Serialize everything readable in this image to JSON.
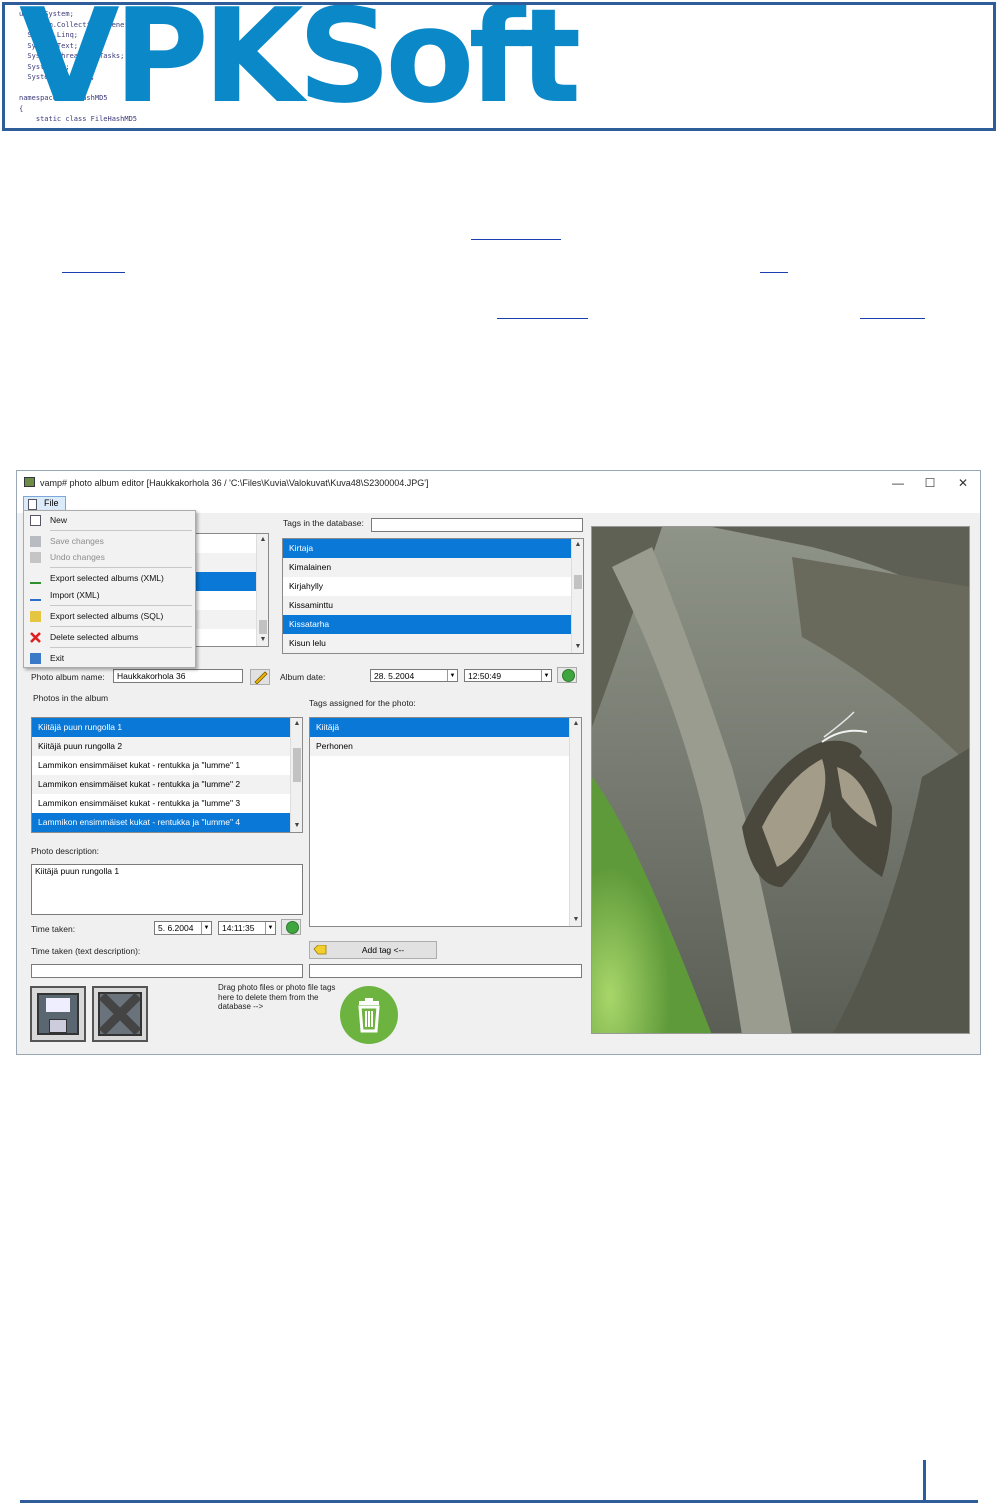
{
  "logo": {
    "text": "VPKSoft",
    "code_lines": [
      "using System;",
      "  System.Collections.Generic;",
      "  System.Linq;",
      "  System.Text;",
      "  System.Threading.Tasks;",
      "  System.IO;",
      "  System.Security;",
      "",
      "namespace FileHashMD5",
      "{",
      "    static class FileHashMD5"
    ]
  },
  "window": {
    "title": "vamp# photo album editor [Haukkakorhola 36 / 'C:\\Files\\Kuvia\\Valokuvat\\Kuva48\\S2300004.JPG']",
    "controls": {
      "minimize": "—",
      "maximize": "☐",
      "close": "✕"
    }
  },
  "menu": {
    "file_label": "File",
    "items": [
      {
        "label": "New",
        "icon": "new-document-icon",
        "enabled": true
      },
      {
        "label": "Save changes",
        "icon": "save-icon",
        "enabled": false
      },
      {
        "label": "Undo changes",
        "icon": "undo-icon",
        "enabled": false
      },
      {
        "label": "Export selected albums (XML)",
        "icon": "export-icon",
        "enabled": true
      },
      {
        "label": "Import (XML)",
        "icon": "import-icon",
        "enabled": true
      },
      {
        "label": "Export selected albums (SQL)",
        "icon": "export-sql-icon",
        "enabled": true
      },
      {
        "label": "Delete selected albums",
        "icon": "delete-icon",
        "enabled": true
      },
      {
        "label": "Exit",
        "icon": "exit-icon",
        "enabled": true
      }
    ]
  },
  "tags_db": {
    "label": "Tags in the database:",
    "filter_value": "",
    "items": [
      {
        "label": "Kirtaja",
        "selected": true
      },
      {
        "label": "Kimalainen",
        "selected": false
      },
      {
        "label": "Kirjahylly",
        "selected": false
      },
      {
        "label": "Kissaminttu",
        "selected": false
      },
      {
        "label": "Kissatarha",
        "selected": true
      },
      {
        "label": "Kisun lelu",
        "selected": false
      }
    ]
  },
  "album": {
    "name_label": "Photo album name:",
    "name_value": "Haukkakorhola 36",
    "date_label": "Album date:",
    "date_value": "28. 5.2004",
    "time_value": "12:50:49"
  },
  "photos": {
    "label": "Photos in the album",
    "items": [
      {
        "label": "Kiitäjä puun rungolla 1",
        "selected": true
      },
      {
        "label": "Kiitäjä puun rungolla 2",
        "selected": false
      },
      {
        "label": "Lammikon ensimmäiset kukat - rentukka ja \"lumme\" 1",
        "selected": false
      },
      {
        "label": "Lammikon ensimmäiset kukat - rentukka ja \"lumme\" 2",
        "selected": false
      },
      {
        "label": "Lammikon ensimmäiset kukat - rentukka ja \"lumme\" 3",
        "selected": false
      },
      {
        "label": "Lammikon ensimmäiset kukat - rentukka ja \"lumme\" 4",
        "selected": true
      }
    ]
  },
  "photo_tags": {
    "label": "Tags assigned for the photo:",
    "items": [
      {
        "label": "Kiitäjä",
        "selected": true
      },
      {
        "label": "Perhonen",
        "selected": false
      }
    ]
  },
  "description": {
    "label": "Photo description:",
    "value": "Kiitäjä puun rungolla 1"
  },
  "time_taken": {
    "label": "Time taken:",
    "date_value": "5. 6.2004",
    "time_value": "14:11:35",
    "text_label": "Time taken (text description):",
    "text_value": ""
  },
  "add_tag": {
    "label": "Add tag <--",
    "input_value": ""
  },
  "drag_hint": "Drag photo files or photo file tags here to delete them from the database -->",
  "colors": {
    "selection": "#0a78d7",
    "logo": "#0a88c8",
    "frame": "#2e5d9a"
  }
}
